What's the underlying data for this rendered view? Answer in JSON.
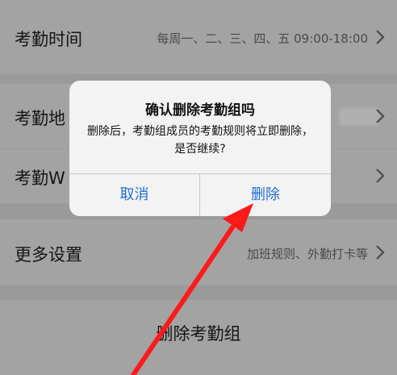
{
  "rows": {
    "attendance_time": {
      "label": "考勤时间",
      "value": "每周一、二、三、四、五 09:00-18:00"
    },
    "attendance_location": {
      "label": "考勤地"
    },
    "attendance_wifi": {
      "label": "考勤W"
    },
    "more_settings": {
      "label": "更多设置",
      "value": "加班规则、外勤打卡等"
    }
  },
  "delete_group_button": {
    "label": "删除考勤组"
  },
  "dialog": {
    "title": "确认删除考勤组吗",
    "message": "删除后，考勤组成员的考勤规则将立即删除，是否继续?",
    "cancel_label": "取消",
    "delete_label": "删除",
    "button_color": "#1f6fe0"
  },
  "annotation": {
    "arrow_color": "#ff1a1a"
  },
  "icons": [
    "chevron-right-icon",
    "annotation-arrow"
  ]
}
